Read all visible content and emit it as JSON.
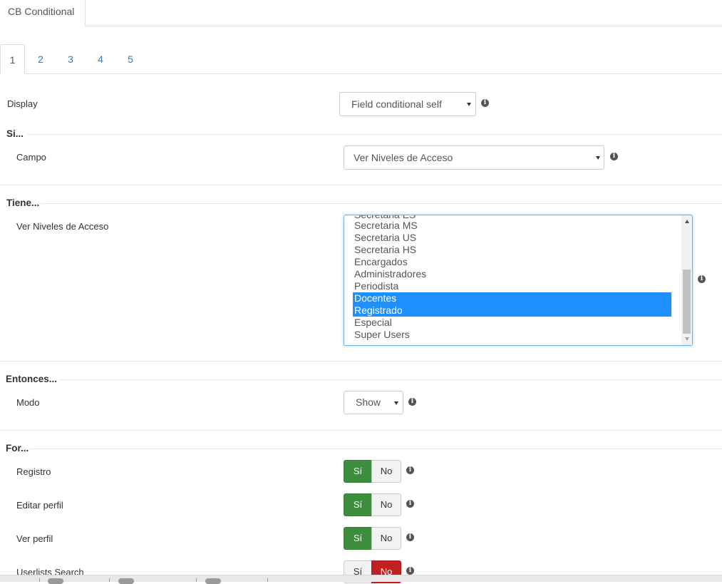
{
  "top_tab": {
    "label": "CB Conditional"
  },
  "num_tabs": [
    {
      "label": "1",
      "active": true
    },
    {
      "label": "2"
    },
    {
      "label": "3"
    },
    {
      "label": "4"
    },
    {
      "label": "5"
    }
  ],
  "display": {
    "label": "Display",
    "value": "Field conditional self"
  },
  "si": {
    "title": "Si...",
    "campo_label": "Campo",
    "campo_value": "Ver Niveles de Acceso"
  },
  "tiene": {
    "title": "Tiene...",
    "field_label": "Ver Niveles de Acceso",
    "options": [
      {
        "label": "Secretaria ES",
        "selected": false
      },
      {
        "label": "Secretaria MS",
        "selected": false
      },
      {
        "label": "Secretaria US",
        "selected": false
      },
      {
        "label": "Secretaria HS",
        "selected": false
      },
      {
        "label": "Encargados",
        "selected": false
      },
      {
        "label": "Administradores",
        "selected": false
      },
      {
        "label": "Periodista",
        "selected": false
      },
      {
        "label": "Docentes",
        "selected": true
      },
      {
        "label": "Registrado",
        "selected": true
      },
      {
        "label": "Especial",
        "selected": false
      },
      {
        "label": "Super Users",
        "selected": false
      }
    ]
  },
  "entonces": {
    "title": "Entonces...",
    "modo_label": "Modo",
    "modo_value": "Show"
  },
  "for": {
    "title": "For...",
    "rows": [
      {
        "label": "Registro",
        "yes": "Sí",
        "no": "No",
        "state": "yes"
      },
      {
        "label": "Editar perfil",
        "yes": "Sí",
        "no": "No",
        "state": "yes"
      },
      {
        "label": "Ver perfil",
        "yes": "Sí",
        "no": "No",
        "state": "yes"
      },
      {
        "label": "Userlists Search",
        "yes": "Sí",
        "no": "No",
        "state": "no"
      }
    ]
  },
  "colors": {
    "accent": "#337ab7",
    "selected": "#1e90ff",
    "toggle_yes": "#3c8d3c",
    "toggle_no": "#c02020"
  },
  "icons": {
    "info": "info-circle-icon",
    "dropdown": "caret-down-icon"
  }
}
